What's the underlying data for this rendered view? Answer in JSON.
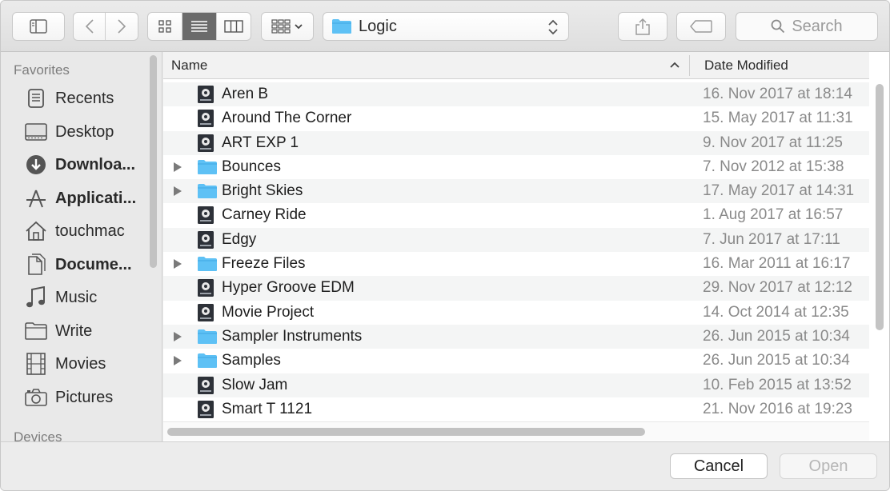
{
  "toolbar": {
    "path_label": "Logic",
    "search_placeholder": "Search"
  },
  "sidebar": {
    "favorites_heading": "Favorites",
    "devices_heading": "Devices",
    "items": [
      {
        "label": "Recents",
        "icon": "recents-icon",
        "bold": false
      },
      {
        "label": "Desktop",
        "icon": "desktop-icon",
        "bold": false
      },
      {
        "label": "Downloa...",
        "icon": "downloads-icon",
        "bold": true
      },
      {
        "label": "Applicati...",
        "icon": "applications-icon",
        "bold": true
      },
      {
        "label": "touchmac",
        "icon": "home-icon",
        "bold": false
      },
      {
        "label": "Docume...",
        "icon": "documents-icon",
        "bold": true
      },
      {
        "label": "Music",
        "icon": "music-icon",
        "bold": false
      },
      {
        "label": "Write",
        "icon": "folder-icon",
        "bold": false
      },
      {
        "label": "Movies",
        "icon": "movies-icon",
        "bold": false
      },
      {
        "label": "Pictures",
        "icon": "camera-icon",
        "bold": false
      }
    ]
  },
  "list": {
    "col_name": "Name",
    "col_date": "Date Modified",
    "sort_indicator": "^",
    "rows": [
      {
        "name": "Aren B",
        "date": "16. Nov 2017 at 18:14",
        "kind": "project"
      },
      {
        "name": "Around The Corner",
        "date": "15. May 2017 at 11:31",
        "kind": "project"
      },
      {
        "name": "ART EXP 1",
        "date": "9. Nov 2017 at 11:25",
        "kind": "project"
      },
      {
        "name": "Bounces",
        "date": "7. Nov 2012 at 15:38",
        "kind": "folder"
      },
      {
        "name": "Bright Skies",
        "date": "17. May 2017 at 14:31",
        "kind": "folder"
      },
      {
        "name": "Carney Ride",
        "date": "1. Aug 2017 at 16:57",
        "kind": "project"
      },
      {
        "name": "Edgy",
        "date": "7. Jun 2017 at 17:11",
        "kind": "project"
      },
      {
        "name": "Freeze Files",
        "date": "16. Mar 2011 at 16:17",
        "kind": "folder"
      },
      {
        "name": "Hyper Groove EDM",
        "date": "29. Nov 2017 at 12:12",
        "kind": "project"
      },
      {
        "name": "Movie Project",
        "date": "14. Oct 2014 at 12:35",
        "kind": "project"
      },
      {
        "name": "Sampler Instruments",
        "date": "26. Jun 2015 at 10:34",
        "kind": "folder"
      },
      {
        "name": "Samples",
        "date": "26. Jun 2015 at 10:34",
        "kind": "folder"
      },
      {
        "name": "Slow Jam",
        "date": "10. Feb 2015 at 13:52",
        "kind": "project"
      },
      {
        "name": "Smart T 1121",
        "date": "21. Nov 2016 at 19:23",
        "kind": "project"
      }
    ]
  },
  "buttons": {
    "cancel": "Cancel",
    "open": "Open"
  },
  "colors": {
    "folder": "#5ec1f5",
    "folder_dark": "#3ea6e3",
    "project_icon_bg": "#2d3138"
  }
}
